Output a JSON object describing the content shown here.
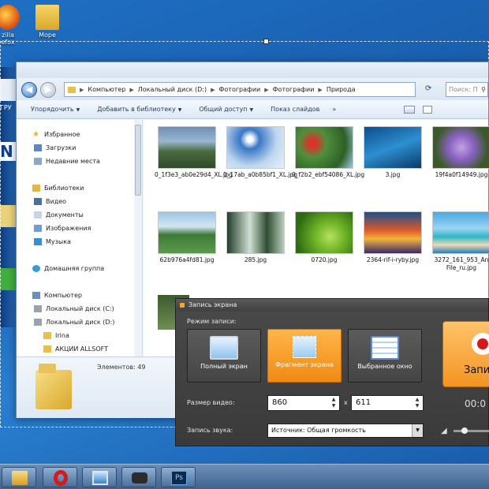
{
  "desktop": {
    "icons": [
      {
        "label": "zilla\nefox"
      },
      {
        "label": "Море"
      }
    ],
    "strip_texts": [
      "ГРУ",
      "N"
    ]
  },
  "explorer": {
    "address": {
      "crumbs": [
        "Компьютер",
        "Локальный диск (D:)",
        "Фотографии",
        "Фотографии",
        "Природа"
      ],
      "search_placeholder": "Поиск: П"
    },
    "toolbar": {
      "organize": "Упорядочить",
      "add_library": "Добавить в библиотеку",
      "share": "Общий доступ",
      "slideshow": "Показ слайдов",
      "more": "»"
    },
    "nav": {
      "favorites": "Избранное",
      "downloads": "Загрузки",
      "recent": "Недавние места",
      "libraries": "Библиотеки",
      "video": "Видео",
      "documents": "Документы",
      "images": "Изображения",
      "music": "Музыка",
      "homegroup": "Домашняя группа",
      "computer": "Компьютер",
      "disk_c": "Локальный диск (C:)",
      "disk_d": "Локальный диск (D:)",
      "irina": "Irina",
      "allsoft": "АКЦИИ ALLSOFT"
    },
    "files": [
      {
        "name": "0_1f3e3_ab0e29d4_XL.jpg"
      },
      {
        "name": "0_17ab_a0b85bf1_XL.jpg"
      },
      {
        "name": "0_f2b2_ebf54086_XL.jpg"
      },
      {
        "name": "3.jpg"
      },
      {
        "name": "19f4a0f14949.jpg"
      },
      {
        "name": "62b976a4fd81.jpg"
      },
      {
        "name": "285.jpg"
      },
      {
        "name": "0720.jpg"
      },
      {
        "name": "2364-rif-i-ryby.jpg"
      },
      {
        "name": "3272_161_953_An File_ru.jpg"
      }
    ],
    "status": {
      "count": "Элементов: 49"
    }
  },
  "recorder": {
    "title": "Запись экрана",
    "mode_label": "Режим записи:",
    "modes": {
      "full": "Полный экран",
      "fragment": "Фрагмент экрана",
      "window": "Выбранное окно"
    },
    "size_label": "Размер видео:",
    "width": "860",
    "height": "611",
    "times": "x",
    "audio_label": "Запись звука:",
    "audio_source": "Источник: Общая громкость",
    "record_label": "Запи",
    "timer": "00:0",
    "volume_level": 0.25
  },
  "colors": {
    "accent": "#f08a12",
    "rec_red": "#d31a1a"
  }
}
